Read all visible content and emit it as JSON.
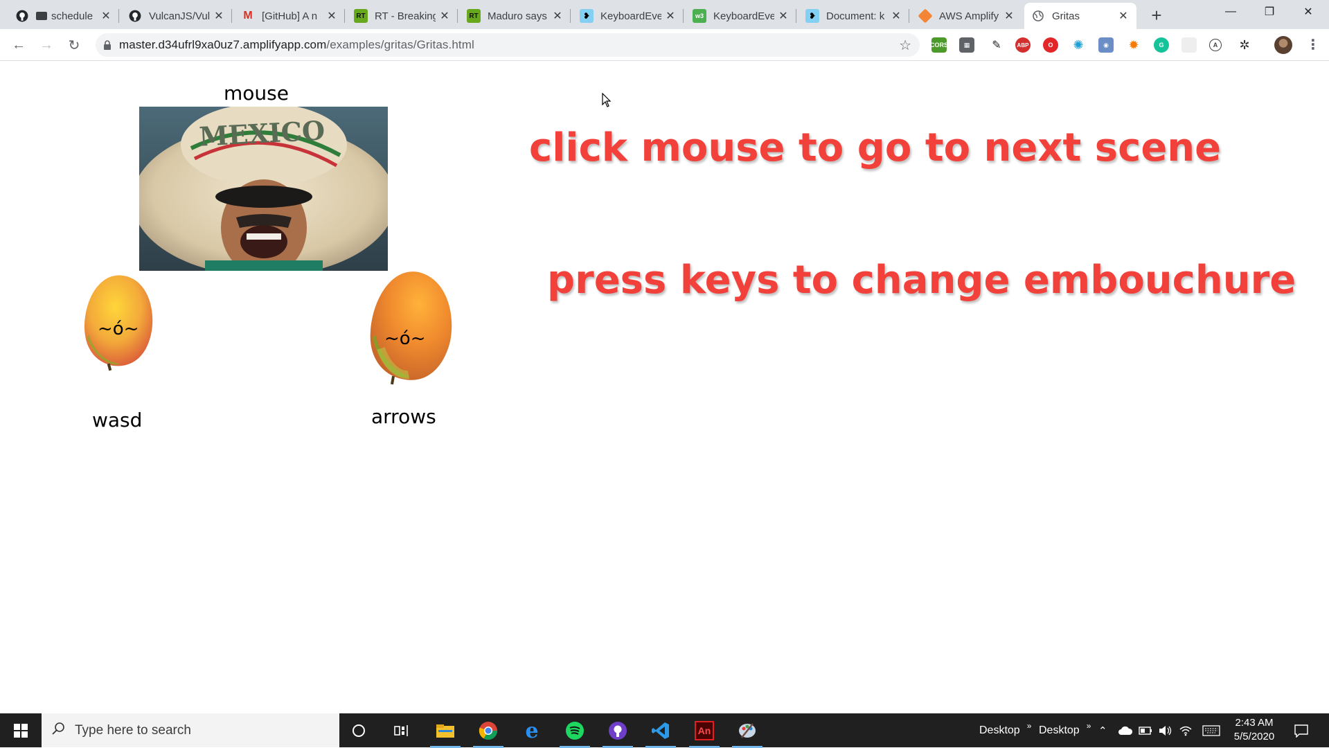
{
  "browser": {
    "tabs": [
      {
        "title": "schedule",
        "favicon": "github-icon",
        "active": false
      },
      {
        "title": "VulcanJS/Vul",
        "favicon": "github-icon",
        "active": false
      },
      {
        "title": "[GitHub] A n",
        "favicon": "gmail-icon",
        "active": false
      },
      {
        "title": "RT - Breaking",
        "favicon": "rt-icon",
        "active": false
      },
      {
        "title": "Maduro says",
        "favicon": "rt-icon",
        "active": false
      },
      {
        "title": "KeyboardEve",
        "favicon": "mdn-icon",
        "active": false
      },
      {
        "title": "KeyboardEve",
        "favicon": "w3-icon",
        "active": false
      },
      {
        "title": "Document: k",
        "favicon": "mdn-icon",
        "active": false
      },
      {
        "title": "AWS Amplify",
        "favicon": "aws-amplify-icon",
        "active": false
      },
      {
        "title": "Gritas",
        "favicon": "globe-icon",
        "active": true
      }
    ],
    "url_host": "master.d34ufrl9xa0uz7.amplifyapp.com",
    "url_path": "/examples/gritas/Gritas.html",
    "extensions": [
      "cors-icon",
      "grid-icon",
      "pen-icon",
      "adblock-icon",
      "opera-icon",
      "gear-icon",
      "camera-icon",
      "burst-icon",
      "grammarly-icon",
      "blank-icon",
      "a-icon",
      "puzzle-icon"
    ]
  },
  "page": {
    "mouse_label": "mouse",
    "wasd_label": "wasd",
    "arrows_label": "arrows",
    "left_face": "~ó~",
    "right_face": "~ó~",
    "hat_text": "MEXICO",
    "instruction_1": "click mouse to go to next scene",
    "instruction_2": "press keys to change embouchure",
    "instruction_color": "#f2413a"
  },
  "taskbar": {
    "search_placeholder": "Type here to search",
    "desktop_1": "Desktop",
    "desktop_2": "Desktop",
    "time": "2:43 AM",
    "date": "5/5/2020"
  }
}
